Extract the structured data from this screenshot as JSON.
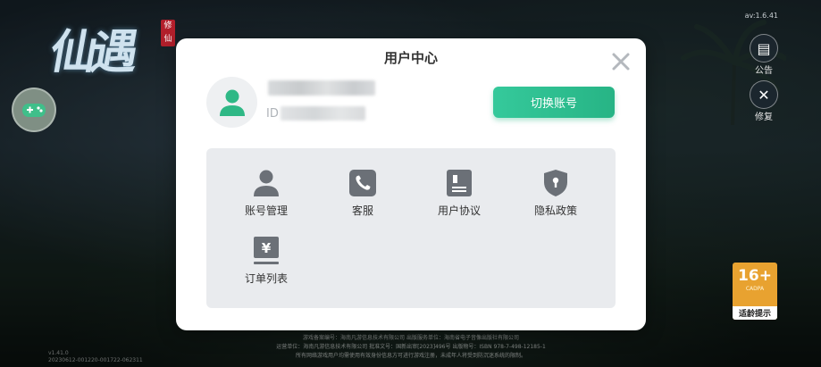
{
  "background": {
    "logo_text": "仙遇",
    "logo_badge": "修仙",
    "version_top": "av:1.6.41",
    "side_buttons": [
      {
        "label": "公告",
        "icon": "notice-icon"
      },
      {
        "label": "修复",
        "icon": "repair-icon"
      }
    ],
    "age_rating": {
      "number": "16+",
      "org": "CADPA",
      "tip": "适龄提示"
    },
    "footer_lines": [
      "游戏备案编号：海南凡游信息技术有限公司   出版服务单位：海南省电子音像出版社有限公司",
      "运营单位：海南凡游信息技术有限公司   批准文号：国新出审[2023]496号   出版物号：ISBN 978-7-498-12185-1",
      "所有网络游戏用户均需使用有效身份信息方可进行游戏注册，未成年人将受到防沉迷系统的限制。"
    ],
    "footer_left": [
      "v1.41.0",
      "20230612-001220-001722-062311"
    ]
  },
  "dialog": {
    "title": "用户中心",
    "id_label": "ID",
    "switch_account_label": "切换账号",
    "menu": [
      {
        "label": "账号管理",
        "icon": "user-icon"
      },
      {
        "label": "客服",
        "icon": "phone-icon"
      },
      {
        "label": "用户协议",
        "icon": "document-icon"
      },
      {
        "label": "隐私政策",
        "icon": "shield-lock-icon"
      },
      {
        "label": "订单列表",
        "icon": "yuan-order-icon"
      }
    ]
  },
  "colors": {
    "accent_green": "#2dbd8d",
    "icon_gray": "#6b7077",
    "panel_bg": "#e9ebee"
  }
}
